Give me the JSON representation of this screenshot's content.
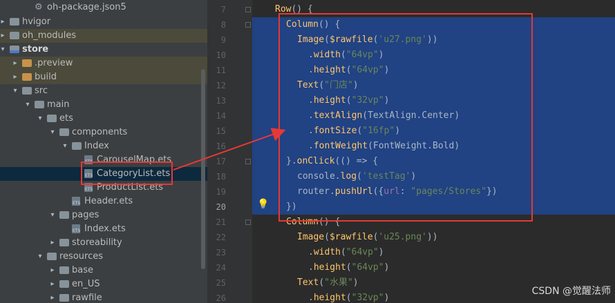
{
  "tree": {
    "items": [
      {
        "label": "oh-package.json5",
        "icon": "gear-file-icon"
      },
      {
        "label": "hvigor",
        "icon": "folder-icon"
      },
      {
        "label": "oh_modules",
        "icon": "folder-icon"
      },
      {
        "label": "store",
        "icon": "module-folder-icon"
      },
      {
        "label": ".preview",
        "icon": "folder-icon"
      },
      {
        "label": "build",
        "icon": "folder-icon"
      },
      {
        "label": "src",
        "icon": "folder-icon"
      },
      {
        "label": "main",
        "icon": "folder-icon"
      },
      {
        "label": "ets",
        "icon": "folder-icon"
      },
      {
        "label": "components",
        "icon": "folder-icon"
      },
      {
        "label": "Index",
        "icon": "folder-icon"
      },
      {
        "label": "CarouselMap.ets",
        "icon": "ets-file-icon"
      },
      {
        "label": "CategoryList.ets",
        "icon": "ets-file-icon"
      },
      {
        "label": "ProductList.ets",
        "icon": "ets-file-icon"
      },
      {
        "label": "Header.ets",
        "icon": "ets-file-icon"
      },
      {
        "label": "pages",
        "icon": "folder-icon"
      },
      {
        "label": "Index.ets",
        "icon": "ets-file-icon"
      },
      {
        "label": "storeability",
        "icon": "folder-icon"
      },
      {
        "label": "resources",
        "icon": "folder-icon"
      },
      {
        "label": "base",
        "icon": "folder-icon"
      },
      {
        "label": "en_US",
        "icon": "folder-icon"
      },
      {
        "label": "rawfile",
        "icon": "folder-icon"
      }
    ]
  },
  "editor": {
    "line_numbers": [
      "7",
      "8",
      "9",
      "10",
      "11",
      "12",
      "13",
      "14",
      "15",
      "16",
      "17",
      "18",
      "19",
      "20",
      "21",
      "22",
      "23",
      "24",
      "25",
      "26"
    ],
    "lines": [
      "Row() {",
      "Column() {",
      "Image($rawfile('u27.png'))",
      ".width(\"64vp\")",
      ".height(\"64vp\")",
      "Text(\"门店\")",
      ".height(\"32vp\")",
      ".textAlign(TextAlign.Center)",
      ".fontSize(\"16fp\")",
      ".fontWeight(FontWeight.Bold)",
      "}.onClick(() => {",
      "console.log('testTag')",
      "router.pushUrl({url: \"pages/Stores\"})",
      "})",
      "Column() {",
      "Image($rawfile('u25.png'))",
      ".width(\"64vp\")",
      ".height(\"64vp\")",
      "Text(\"水果\")",
      ".height(\"32vp\")"
    ]
  },
  "watermark": "CSDN @觉醒法师",
  "colors": {
    "annotation": "#e53935",
    "selection": "#214283",
    "tree_bg": "#3c3f41",
    "editor_bg": "#2b2b2b"
  }
}
